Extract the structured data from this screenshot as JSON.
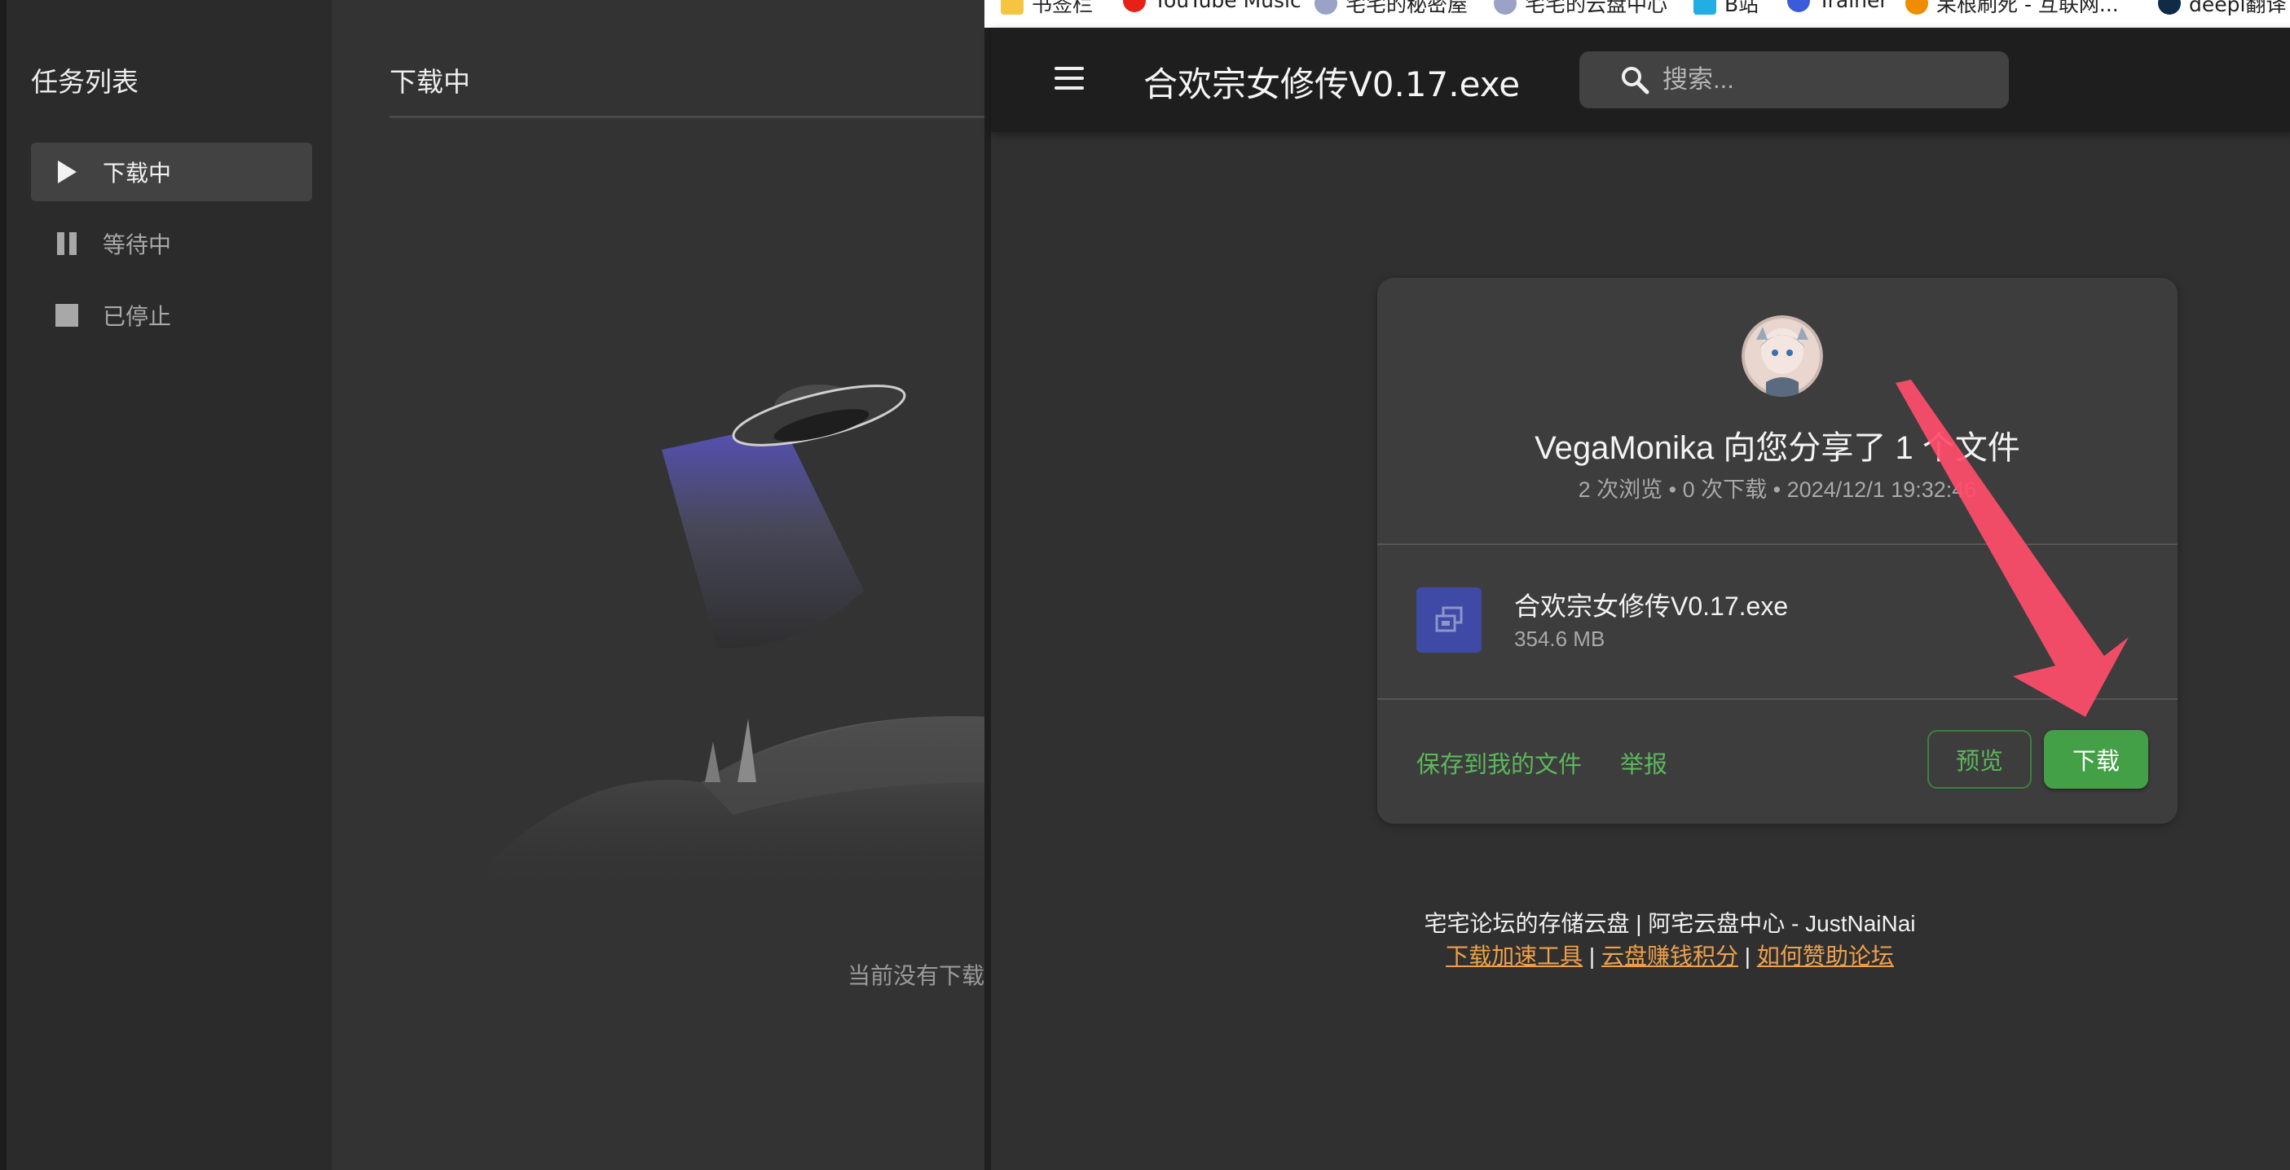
{
  "download_manager": {
    "sidebar_title": "任务列表",
    "nav": [
      {
        "label": "下载中",
        "icon": "play-icon"
      },
      {
        "label": "等待中",
        "icon": "pause-icon"
      },
      {
        "label": "已停止",
        "icon": "stop-icon"
      }
    ],
    "main_title": "下载中",
    "empty_text": "当前没有下载"
  },
  "bookmarks": [
    {
      "label": "书签栏",
      "icon": "folder-icon",
      "color": "#f5c542"
    },
    {
      "label": "YouTube Music",
      "icon": "youtube-music-icon",
      "color": "#e62117"
    },
    {
      "label": "宅宅的秘密屋",
      "icon": "avatar-icon",
      "color": "#9aa3c7"
    },
    {
      "label": "宅宅的云盘中心",
      "icon": "avatar-icon",
      "color": "#9aa3c7"
    },
    {
      "label": "B站",
      "icon": "bilibili-icon",
      "color": "#23ade5"
    },
    {
      "label": "Trainer",
      "icon": "trainer-icon",
      "color": "#3b5bdb"
    },
    {
      "label": "呆根刷死 - 互联网...",
      "icon": "moon-icon",
      "color": "#f08c00"
    },
    {
      "label": "deepl翻译",
      "icon": "deepl-icon",
      "color": "#0f2b46"
    }
  ],
  "page": {
    "title": "合欢宗女修传V0.17.exe",
    "search": {
      "placeholder": "搜索..."
    }
  },
  "share": {
    "title": "VegaMonika 向您分享了 1 个文件",
    "meta": "2 次浏览 • 0 次下载 • 2024/12/1 19:32:46",
    "file": {
      "name": "合欢宗女修传V0.17.exe",
      "size": "354.6 MB",
      "icon_color": "#3f4aa6"
    },
    "actions": {
      "save": "保存到我的文件",
      "report": "举报",
      "preview": "预览",
      "download": "下载"
    }
  },
  "footer": {
    "line1": "宅宅论坛的存储云盘 | 阿宅云盘中心 - JustNaiNai",
    "links": [
      "下载加速工具",
      "云盘赚钱积分",
      "如何赞助论坛"
    ],
    "separator": "|"
  },
  "colors": {
    "accent_green": "#43a047",
    "link_green": "#5cb85c",
    "footer_link": "#f0a04b",
    "annotation_arrow": "#ff4d6a"
  }
}
